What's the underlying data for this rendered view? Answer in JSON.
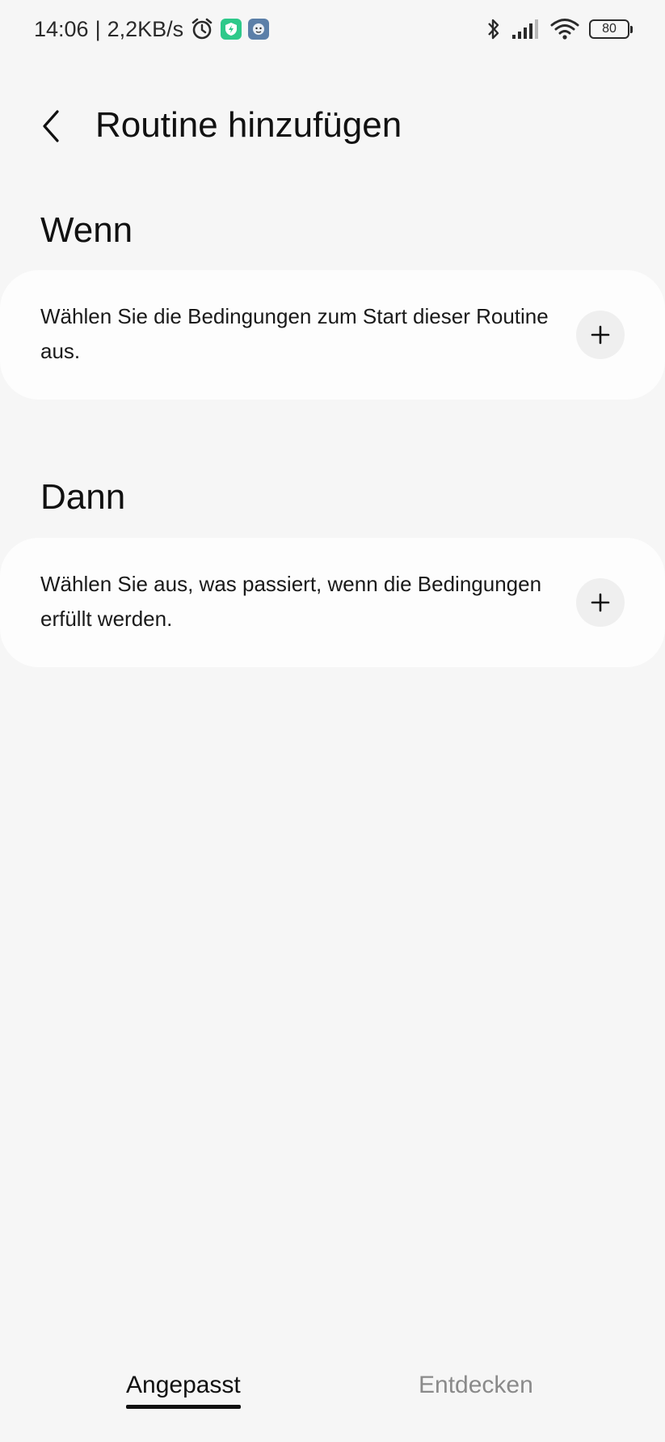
{
  "status_bar": {
    "time": "14:06",
    "separator": "|",
    "network_speed": "2,2KB/s",
    "battery_level": "80",
    "left_icons": [
      "alarm-icon",
      "shield-app-icon",
      "face-app-icon"
    ],
    "right_icons": [
      "bluetooth-icon",
      "cellular-signal-icon",
      "wifi-icon",
      "battery-icon"
    ]
  },
  "header": {
    "back_icon": "chevron-left-icon",
    "title": "Routine hinzufügen"
  },
  "if_section": {
    "heading": "Wenn",
    "description": "Wählen Sie die Bedingungen zum Start dieser Routine aus.",
    "add_icon": "plus-icon"
  },
  "then_section": {
    "heading": "Dann",
    "description": "Wählen Sie aus, was passiert, wenn die Bedingungen erfüllt werden.",
    "add_icon": "plus-icon"
  },
  "tabs": [
    {
      "label": "Angepasst",
      "selected": true
    },
    {
      "label": "Entdecken",
      "selected": false
    }
  ],
  "colors": {
    "background": "#f6f6f6",
    "card": "#fdfdfd",
    "text_primary": "#111111",
    "tab_inactive": "#8a8a8a",
    "shield_app": "#2ec98a",
    "face_app": "#5b7fa8"
  }
}
